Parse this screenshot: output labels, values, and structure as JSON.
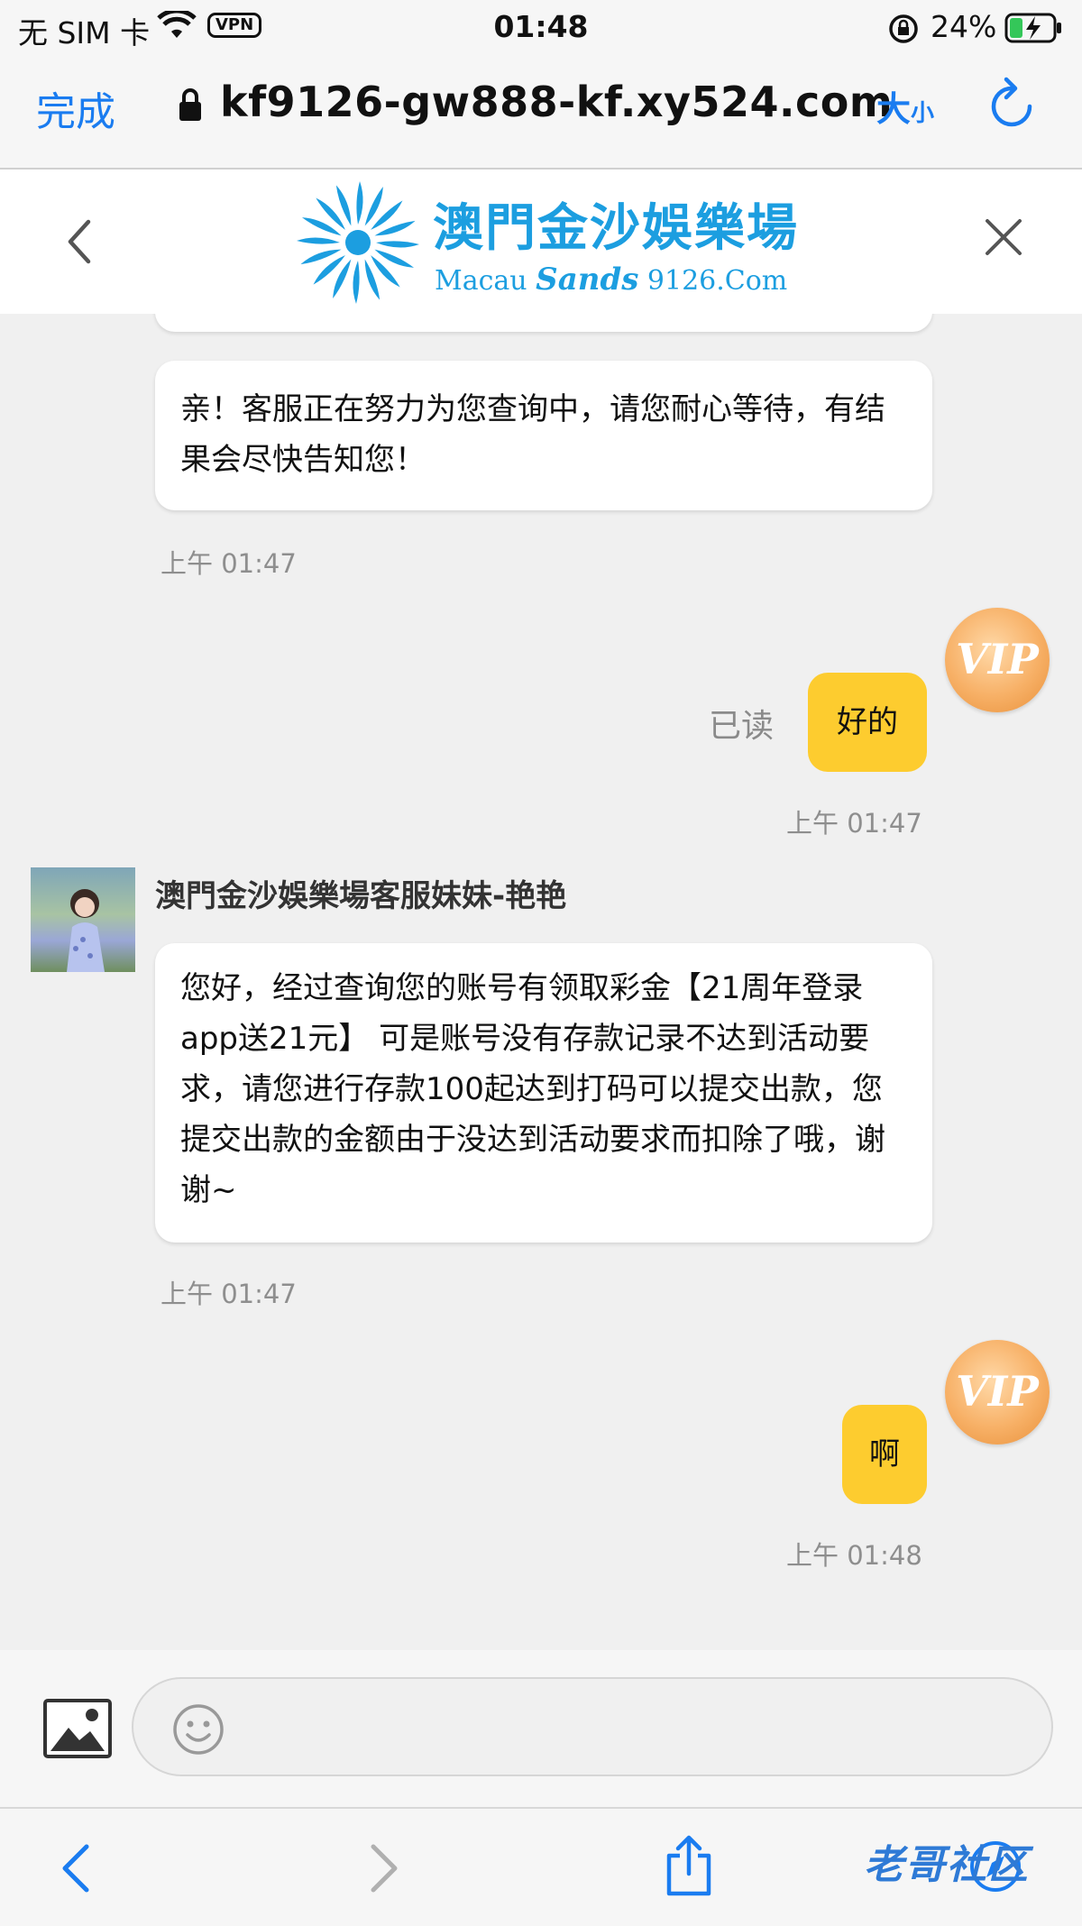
{
  "status_bar": {
    "carrier": "无 SIM 卡",
    "vpn": "VPN",
    "time": "01:48",
    "battery": "24%"
  },
  "browser": {
    "done_label": "完成",
    "url": "kf9126-gw888-kf.xy524.com",
    "text_size_large": "大",
    "text_size_small": "小"
  },
  "header": {
    "logo_cn": "澳門金沙娛樂場",
    "logo_en_pre": "Macau ",
    "logo_en_mid": "Sands",
    "logo_en_post": " 9126.Com"
  },
  "messages": [
    {
      "from": "agent",
      "text": "亲！客服正在努力为您查询中，请您耐心等待，有结果会尽快告知您！",
      "time": "上午 01:47"
    },
    {
      "from": "user",
      "text": "好的",
      "status": "已读",
      "badge": "VIP",
      "time": "上午 01:47"
    },
    {
      "from": "agent",
      "name": "澳門金沙娛樂場客服妹妹-艳艳",
      "text": "您好，经过查询您的账号有领取彩金【21周年登录app送21元】 可是账号没有存款记录不达到活动要求，请您进行存款100起达到打码可以提交出款，您提交出款的金额由于没达到活动要求而扣除了哦，谢谢~",
      "time": "上午 01:47"
    },
    {
      "from": "user",
      "text": "啊",
      "badge": "VIP",
      "time": "上午 01:48"
    }
  ],
  "input": {
    "placeholder": ""
  },
  "watermark": "老哥社区",
  "colors": {
    "accent": "#1a7cf0",
    "user_bubble": "#fdcc2f",
    "brand": "#1c9ee0"
  }
}
